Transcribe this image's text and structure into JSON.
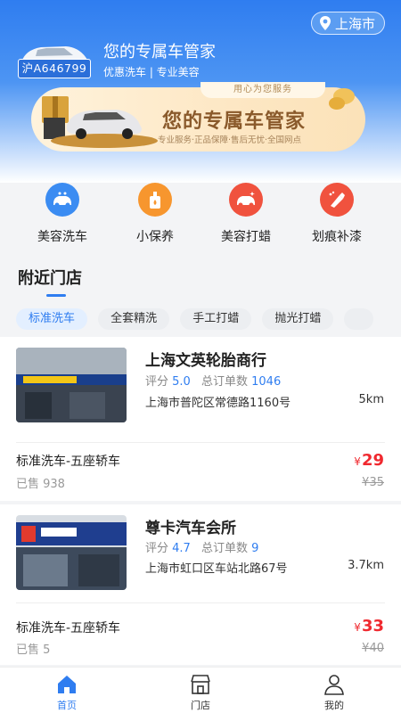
{
  "header": {
    "city": "上海市",
    "plate": "沪A646799",
    "title": "您的专属车管家",
    "subtitle": "优惠洗车 | 专业美容"
  },
  "banner": {
    "tagline": "用心为您服务",
    "title": "您的专属车管家",
    "subtitle": "专业服务·正品保障·售后无忧·全国网点"
  },
  "services": [
    {
      "label": "美容洗车",
      "icon": "car-wash-icon",
      "color": "#3b8cf2"
    },
    {
      "label": "小保养",
      "icon": "oil-bottle-icon",
      "color": "#f7962e"
    },
    {
      "label": "美容打蜡",
      "icon": "car-wax-icon",
      "color": "#f0523e"
    },
    {
      "label": "划痕补漆",
      "icon": "spray-paint-icon",
      "color": "#f0523e"
    }
  ],
  "nearby": {
    "title": "附近门店",
    "chips": [
      "标准洗车",
      "全套精洗",
      "手工打蜡",
      "抛光打蜡"
    ]
  },
  "stores": [
    {
      "name": "上海文英轮胎商行",
      "rating_label": "评分",
      "rating": "5.0",
      "orders_label": "总订单数",
      "orders": "1046",
      "address": "上海市普陀区常德路1160号",
      "distance": "5km",
      "service": "标准洗车-五座轿车",
      "sold": "已售 938",
      "currency": "¥",
      "price": "29",
      "original_price": "¥35"
    },
    {
      "name": "尊卡汽车会所",
      "rating_label": "评分",
      "rating": "4.7",
      "orders_label": "总订单数",
      "orders": "9",
      "address": "上海市虹口区车站北路67号",
      "distance": "3.7km",
      "service": "标准洗车-五座轿车",
      "sold": "已售 5",
      "currency": "¥",
      "price": "33",
      "original_price": "¥40"
    }
  ],
  "tabbar": [
    {
      "label": "首页",
      "icon": "home-icon",
      "active": true
    },
    {
      "label": "门店",
      "icon": "store-icon",
      "active": false
    },
    {
      "label": "我的",
      "icon": "user-icon",
      "active": false
    }
  ],
  "colors": {
    "accent": "#2f7df0",
    "price": "#f0292f"
  }
}
